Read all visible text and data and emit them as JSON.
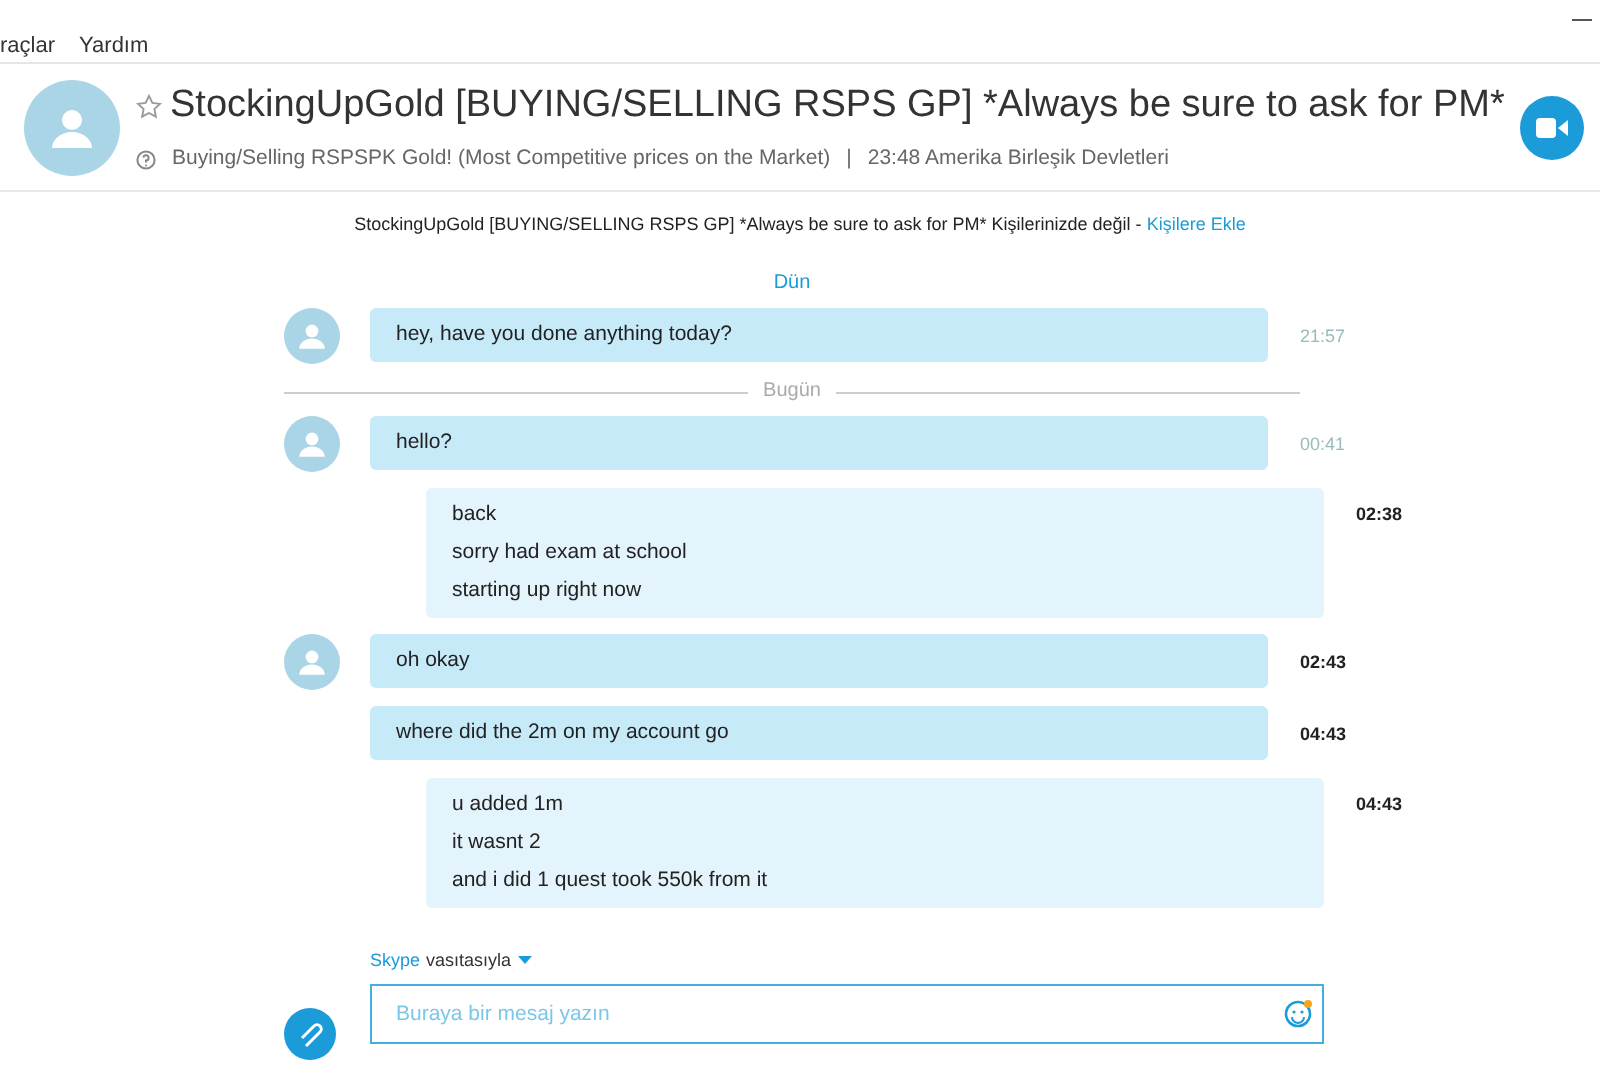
{
  "menu": [
    "raçlar",
    "Yardım"
  ],
  "contact": {
    "name": "StockingUpGold [BUYING/SELLING RSPS GP] *Always be sure to ask for PM*",
    "favorite": false,
    "mood": "Buying/Selling RSPSPK Gold! (Most Competitive prices on the Market)",
    "separator": "|",
    "local_time": "23:48 Amerika Birleşik Devletleri"
  },
  "notice": {
    "text": "StockingUpGold [BUYING/SELLING RSPS GP] *Always be sure to ask for PM* Kişilerinizde değil -",
    "link": "Kişilere Ekle"
  },
  "messages": [
    {
      "kind": "day",
      "label": "Dün",
      "line": false
    },
    {
      "kind": "incoming",
      "avatar": true,
      "lines": [
        "hey, have you done anything today?"
      ],
      "time": "21:57",
      "unread": false
    },
    {
      "kind": "day",
      "label": "Bugün",
      "line": true
    },
    {
      "kind": "incoming",
      "avatar": true,
      "lines": [
        "hello?"
      ],
      "time": "00:41",
      "unread": false
    },
    {
      "kind": "outgoing",
      "lines": [
        "back",
        "sorry had exam at school",
        "starting up right now"
      ],
      "time": "02:38",
      "unread": true
    },
    {
      "kind": "incoming",
      "avatar": true,
      "lines": [
        "oh okay"
      ],
      "time": "02:43",
      "unread": true
    },
    {
      "kind": "incoming",
      "avatar": false,
      "lines": [
        "where did the 2m on my account go"
      ],
      "time": "04:43",
      "unread": true
    },
    {
      "kind": "outgoing",
      "lines": [
        "u added 1m",
        "it wasnt 2",
        "and i did 1 quest took 550k from it"
      ],
      "time": "04:43",
      "unread": true
    }
  ],
  "via": {
    "service": "Skype",
    "text": "vasıtasıyla"
  },
  "composer": {
    "placeholder": "Buraya bir mesaj yazın"
  }
}
